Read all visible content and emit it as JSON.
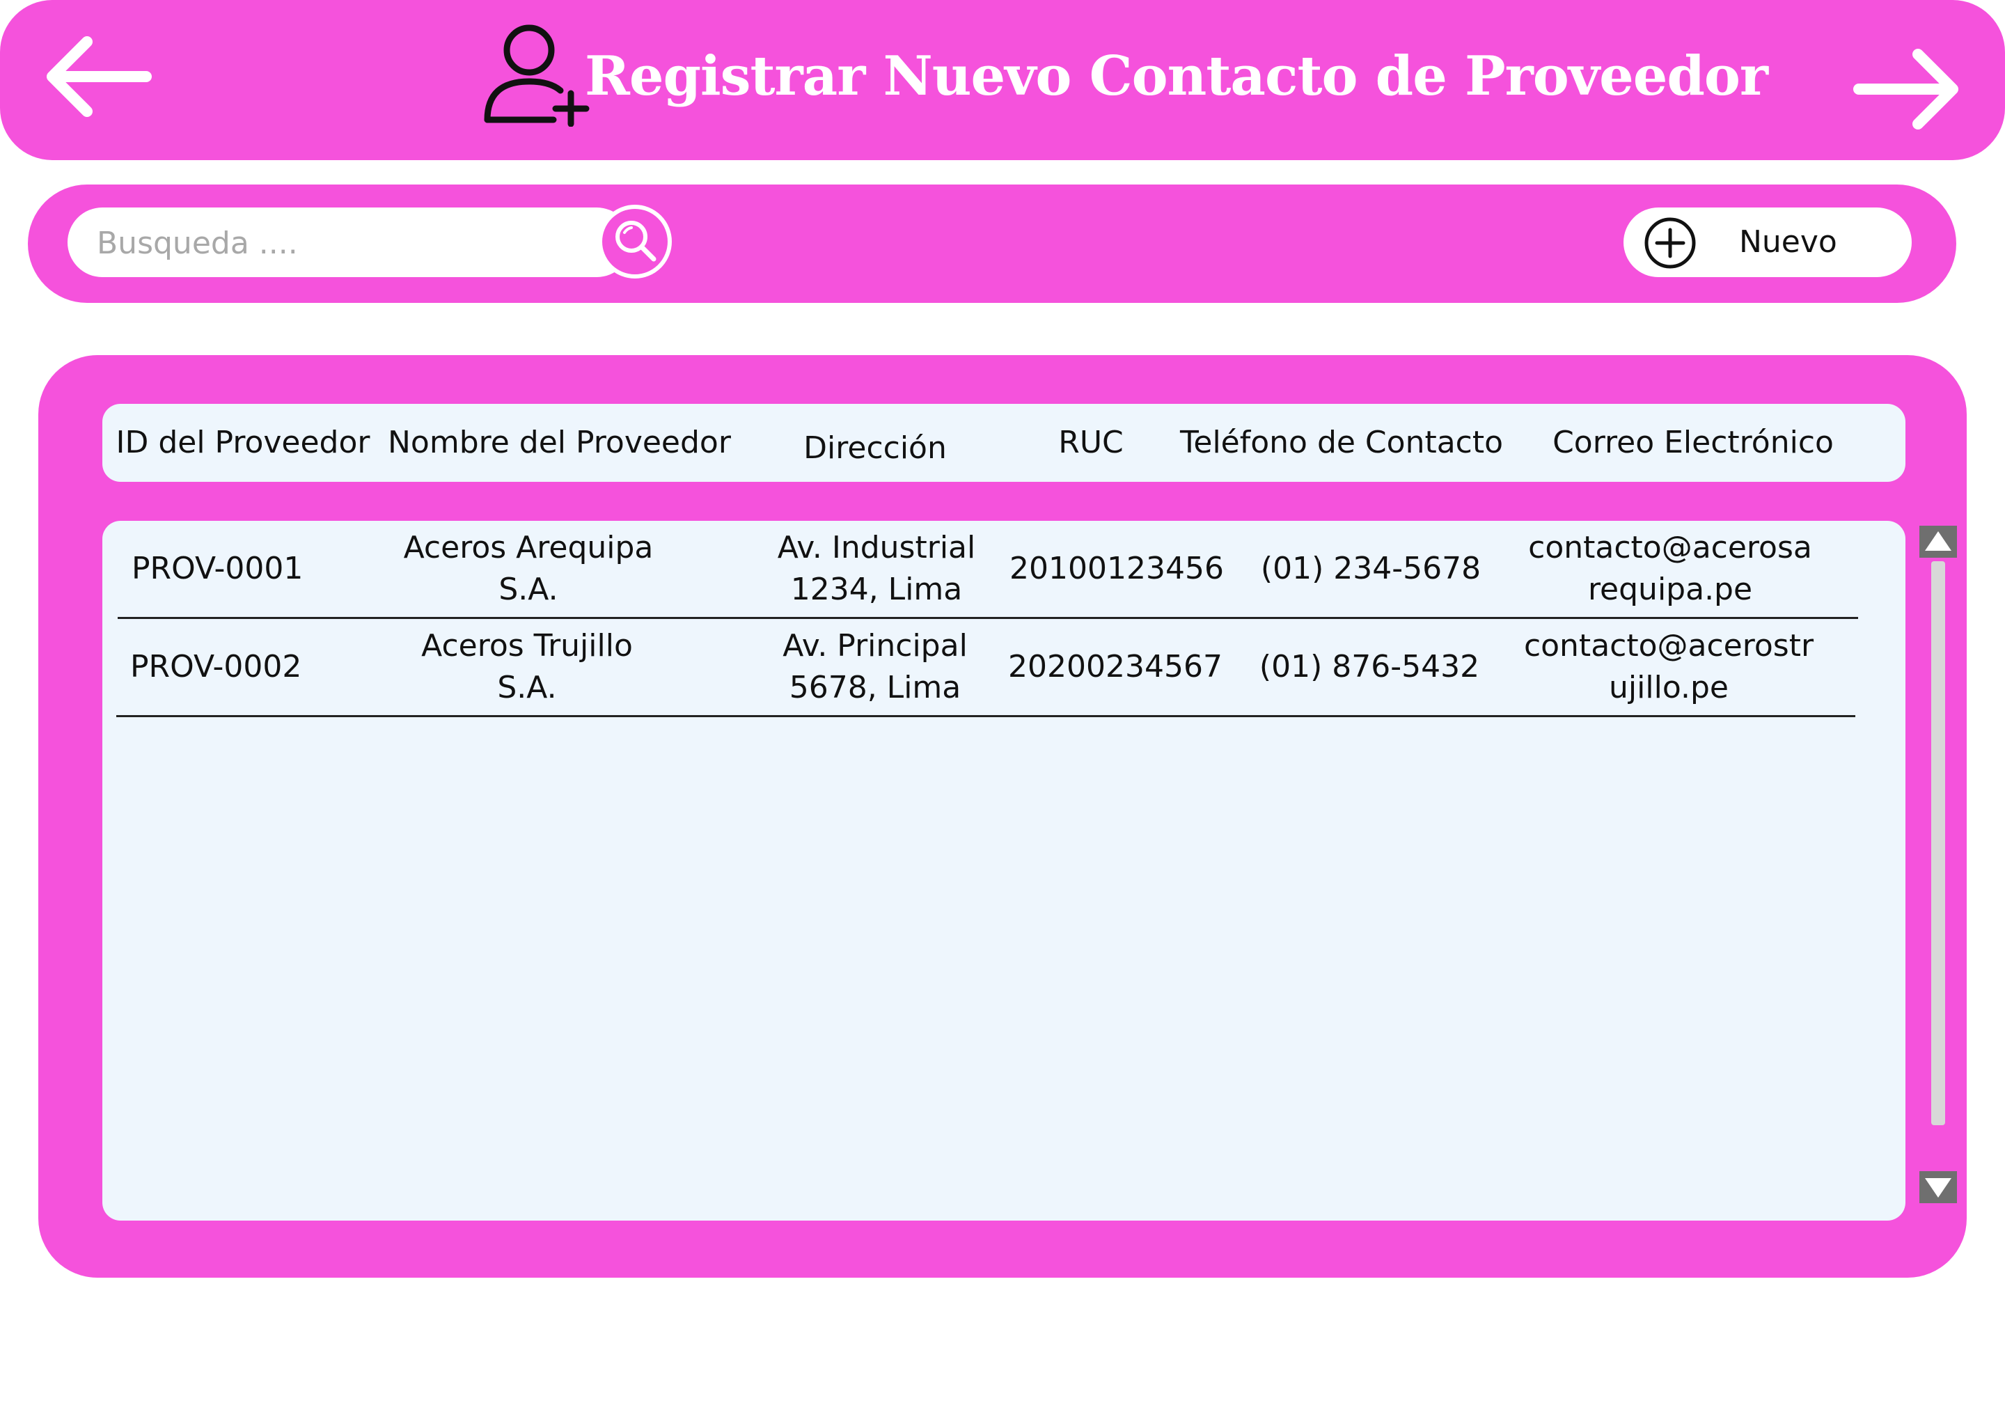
{
  "header": {
    "title": "Registrar Nuevo Contacto de Proveedor",
    "back_icon": "arrow-left-icon",
    "forward_icon": "arrow-right-icon",
    "title_icon": "user-add-icon"
  },
  "toolbar": {
    "search_placeholder": "Busqueda ....",
    "search_value": "",
    "search_icon": "search-icon",
    "new_label": "Nuevo",
    "new_icon": "plus-circle-icon"
  },
  "table": {
    "columns": [
      "ID del Proveedor",
      "Nombre del Proveedor",
      "Dirección",
      "RUC",
      "Teléfono de Contacto",
      "Correo Electrónico"
    ],
    "rows": [
      {
        "id": "PROV-0001",
        "nombre": "Aceros Arequipa S.A.",
        "direccion": "Av. Industrial 1234, Lima",
        "ruc": "20100123456",
        "telefono": "(01) 234-5678",
        "correo": "contacto@acerosarequipa.pe"
      },
      {
        "id": "PROV-0002",
        "nombre": "Aceros Trujillo S.A.",
        "direccion": "Av. Principal 5678, Lima",
        "ruc": "20200234567",
        "telefono": "(01) 876-5432",
        "correo": "contacto@acerostrujillo.pe"
      }
    ]
  },
  "scrollbar": {
    "up_icon": "triangle-up-icon",
    "down_icon": "triangle-down-icon"
  },
  "colors": {
    "accent": "#f552dc",
    "panel": "#eef6fd",
    "text": "#111111"
  }
}
